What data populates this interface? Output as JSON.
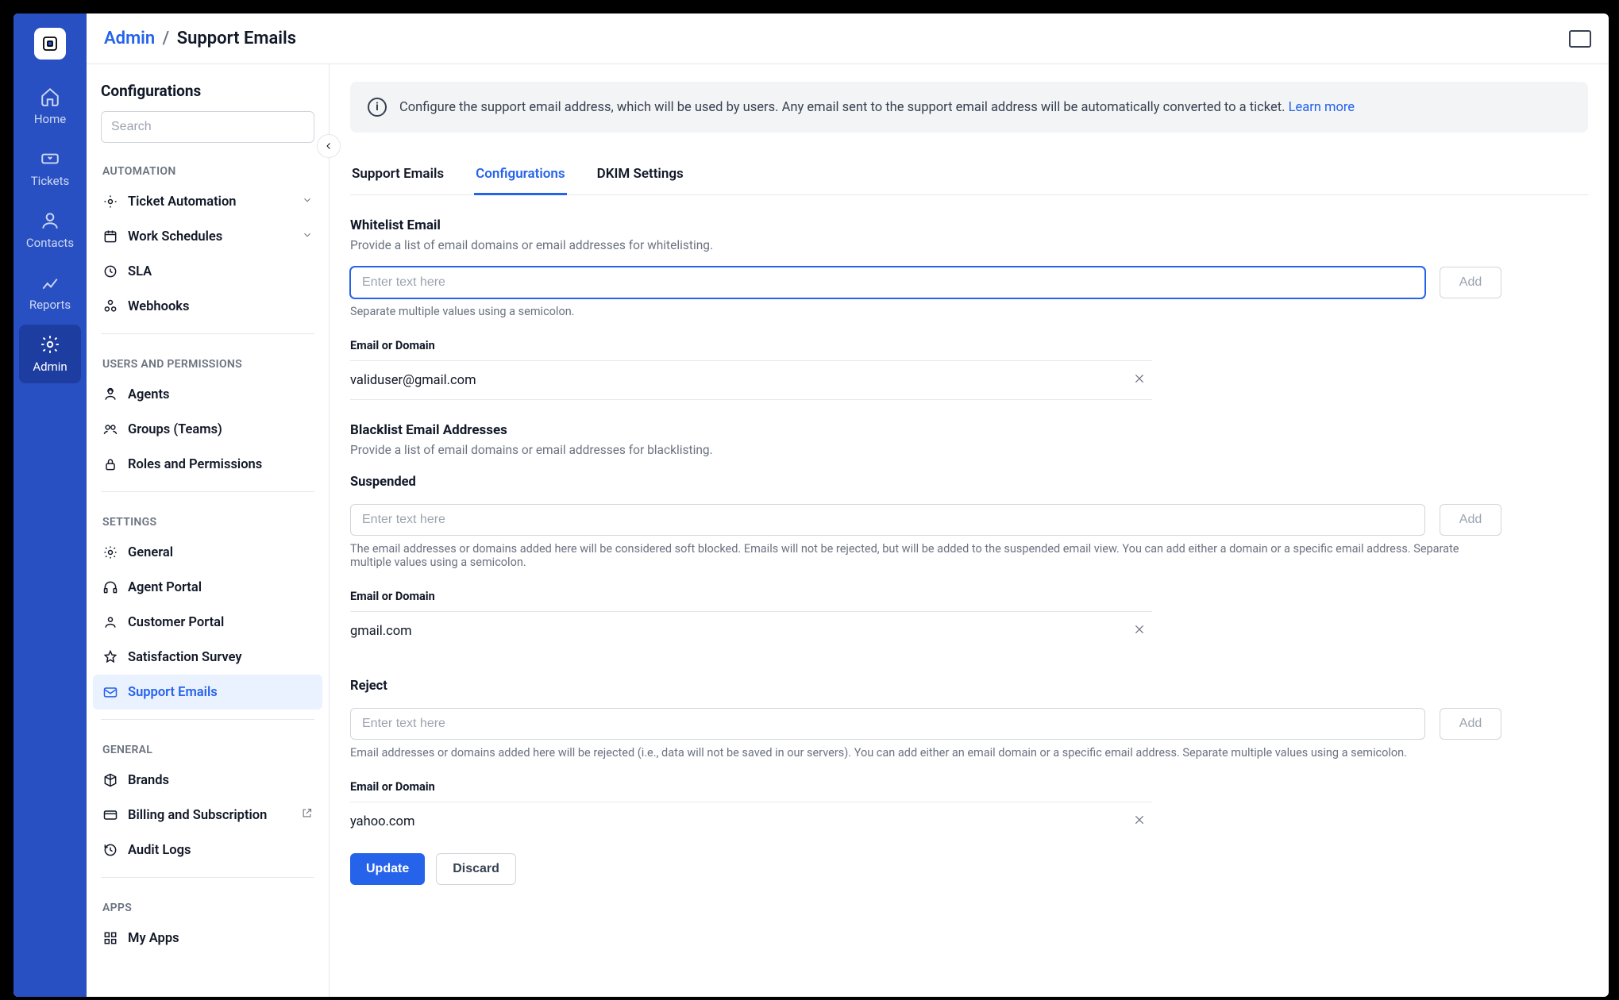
{
  "nav": {
    "items": [
      {
        "label": "Home"
      },
      {
        "label": "Tickets"
      },
      {
        "label": "Contacts"
      },
      {
        "label": "Reports"
      },
      {
        "label": "Admin"
      }
    ]
  },
  "breadcrumb": {
    "root": "Admin",
    "current": "Support Emails"
  },
  "sidebar": {
    "title": "Configurations",
    "search_placeholder": "Search",
    "groups": {
      "automation": {
        "label": "AUTOMATION",
        "items": [
          "Ticket Automation",
          "Work Schedules",
          "SLA",
          "Webhooks"
        ]
      },
      "users": {
        "label": "USERS AND PERMISSIONS",
        "items": [
          "Agents",
          "Groups (Teams)",
          "Roles and Permissions"
        ]
      },
      "settings": {
        "label": "SETTINGS",
        "items": [
          "General",
          "Agent Portal",
          "Customer Portal",
          "Satisfaction Survey",
          "Support Emails"
        ]
      },
      "general": {
        "label": "GENERAL",
        "items": [
          "Brands",
          "Billing and Subscription",
          "Audit Logs"
        ]
      },
      "apps": {
        "label": "APPS",
        "items": [
          "My Apps"
        ]
      }
    }
  },
  "banner": {
    "text": "Configure the support email address, which will be used by users. Any email sent to the support email address will be automatically converted to a ticket. ",
    "link": "Learn more"
  },
  "tabs": [
    "Support Emails",
    "Configurations",
    "DKIM Settings"
  ],
  "whitelist": {
    "title": "Whitelist Email",
    "desc": "Provide a list of email domains or email addresses for whitelisting.",
    "placeholder": "Enter text here",
    "add": "Add",
    "helper": "Separate multiple values using a semicolon.",
    "col": "Email or Domain",
    "rows": [
      "validuser@gmail.com"
    ]
  },
  "blacklist": {
    "title": "Blacklist Email Addresses",
    "desc": "Provide a list of email domains or email addresses for blacklisting."
  },
  "suspended": {
    "label": "Suspended",
    "placeholder": "Enter text here",
    "add": "Add",
    "helper": "The email addresses or domains added here will be considered soft blocked. Emails will not be rejected, but will be added to the suspended email view. You can add either a domain or a specific email address. Separate multiple values using a semicolon.",
    "col": "Email or Domain",
    "rows": [
      "gmail.com"
    ]
  },
  "reject": {
    "label": "Reject",
    "placeholder": "Enter text here",
    "add": "Add",
    "helper": "Email addresses or domains added here will be rejected (i.e., data will not be saved in our servers). You can add either an email domain or a specific email address. Separate multiple values using a semicolon.",
    "col": "Email or Domain",
    "rows": [
      "yahoo.com"
    ]
  },
  "actions": {
    "update": "Update",
    "discard": "Discard"
  }
}
